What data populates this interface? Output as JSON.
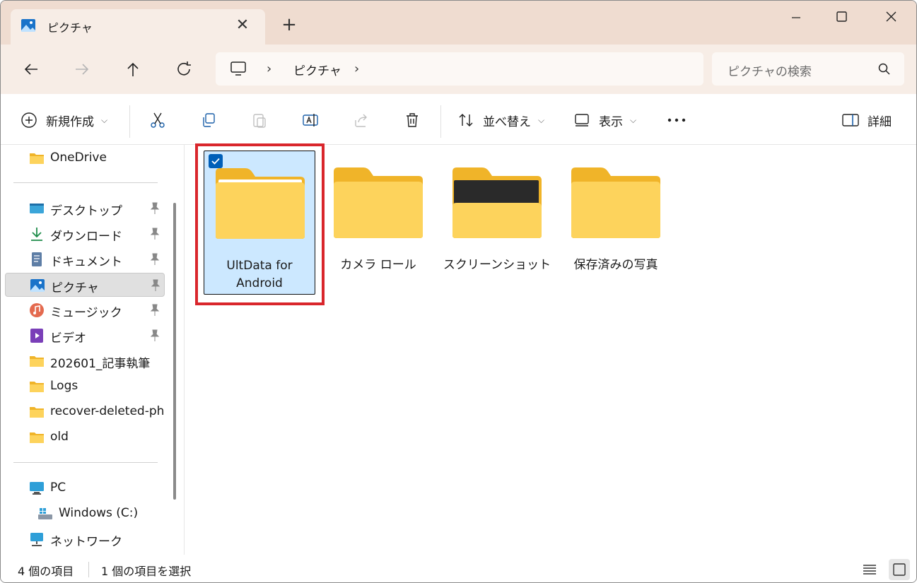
{
  "window": {
    "tab_title": "ピクチャ",
    "tab_close": "✕",
    "new_tab": "+"
  },
  "address": {
    "crumb": "ピクチャ",
    "sep": "›",
    "search_placeholder": "ピクチャの検索"
  },
  "commands": {
    "new": "新規作成",
    "sort": "並べ替え",
    "view": "表示",
    "details": "詳細",
    "caret": "⌵"
  },
  "sidebar": {
    "items": [
      {
        "label": "OneDrive"
      },
      {
        "label": "デスクトップ"
      },
      {
        "label": "ダウンロード"
      },
      {
        "label": "ドキュメント"
      },
      {
        "label": "ピクチャ"
      },
      {
        "label": "ミュージック"
      },
      {
        "label": "ビデオ"
      },
      {
        "label": "202601_記事執筆"
      },
      {
        "label": "Logs"
      },
      {
        "label": "recover-deleted-pho"
      },
      {
        "label": "old"
      },
      {
        "label": "PC"
      },
      {
        "label": "Windows (C:)"
      },
      {
        "label": "ネットワーク"
      }
    ]
  },
  "folders": [
    {
      "line1": "UltData for",
      "line2": "Android",
      "selected": true
    },
    {
      "line1": "カメラ ロール",
      "line2": ""
    },
    {
      "line1": "スクリーンショット",
      "line2": ""
    },
    {
      "line1": "保存済みの写真",
      "line2": ""
    }
  ],
  "status": {
    "count": "4 個の項目",
    "selected": "1 個の項目を選択"
  },
  "colors": {
    "accent": "#005fb8",
    "titlebar": "#efdcd0",
    "folder": "#f8c94a",
    "highlight": "#d9262c"
  }
}
